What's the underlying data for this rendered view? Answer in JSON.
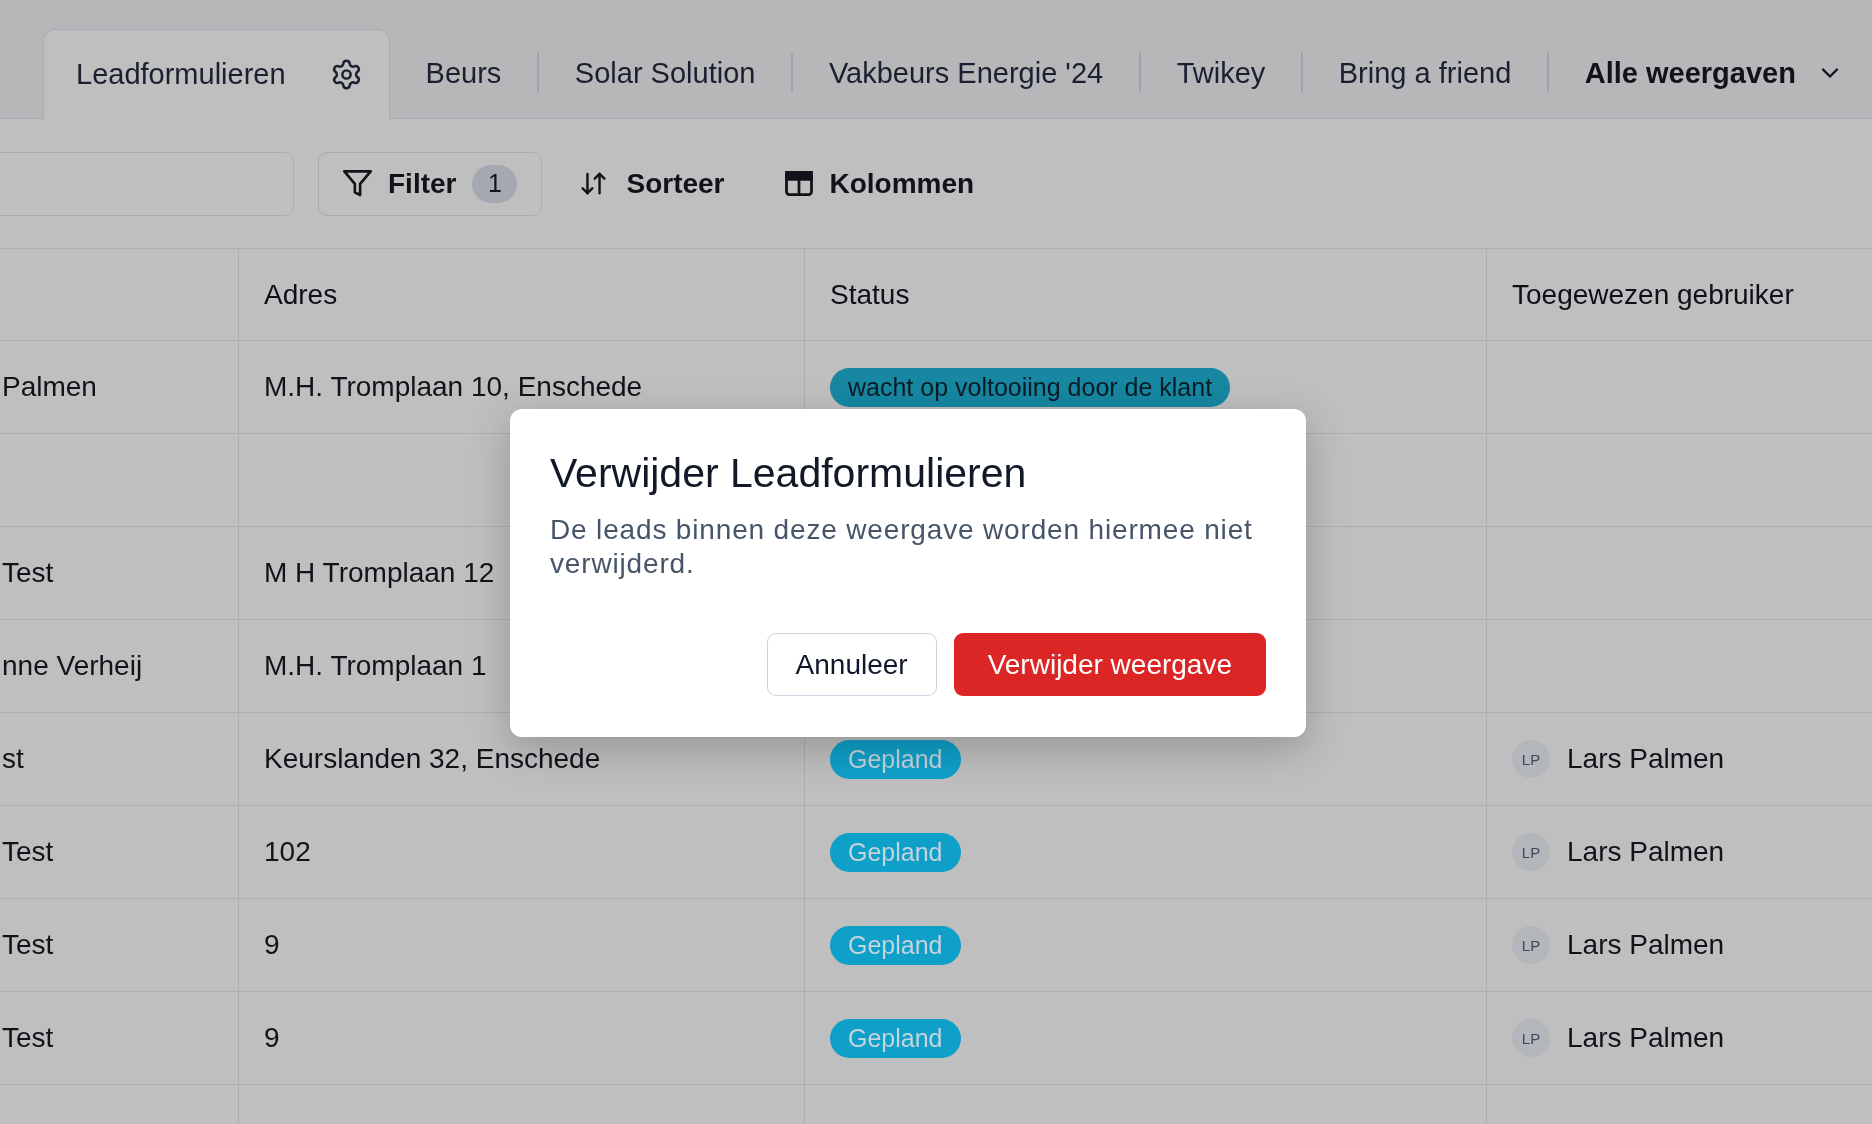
{
  "tabs": [
    {
      "label": "Leadformulieren",
      "selected": true
    },
    {
      "label": "Beurs",
      "selected": false
    },
    {
      "label": "Solar Solution",
      "selected": false
    },
    {
      "label": "Vakbeurs Energie '24",
      "selected": false
    },
    {
      "label": "Twikey",
      "selected": false
    },
    {
      "label": "Bring a friend",
      "selected": false
    }
  ],
  "views_menu": {
    "label": "Alle weergaven"
  },
  "toolbar": {
    "actions": [
      {
        "kind": "filter",
        "label": "Filter",
        "count": "1"
      },
      {
        "kind": "sort",
        "label": "Sorteer"
      },
      {
        "kind": "columns",
        "label": "Kolommen"
      }
    ]
  },
  "table": {
    "columns": [
      "Adres",
      "Status",
      "Toegewezen gebruiker"
    ],
    "rows": [
      {
        "column_1": "Palmen",
        "address": "M.H. Tromplaan 10, Enschede",
        "status": {
          "label": "wacht op voltooiing door de klant",
          "kind": "dark",
          "color": "#1787a2"
        }
      },
      {},
      {
        "column_1": "Test",
        "address": "M H Tromplaan 12"
      },
      {
        "column_1": "nne Verheij",
        "address": "M.H. Tromplaan 1"
      },
      {
        "column_1": "st",
        "address": "Keurslanden 32, Enschede",
        "status": {
          "label": "Gepland",
          "kind": "light",
          "color": "#0fa0c9"
        },
        "assigned_user": {
          "initials": "LP",
          "name": "Lars Palmen"
        }
      },
      {
        "column_1": "Test",
        "address": "102",
        "status": {
          "label": "Gepland",
          "kind": "light",
          "color": "#0fa0c9"
        },
        "assigned_user": {
          "initials": "LP",
          "name": "Lars Palmen"
        }
      },
      {
        "column_1": "Test",
        "address": "9",
        "status": {
          "label": "Gepland",
          "kind": "light",
          "color": "#0fa0c9"
        },
        "assigned_user": {
          "initials": "LP",
          "name": "Lars Palmen"
        }
      },
      {
        "column_1": "Test",
        "address": "9",
        "status": {
          "label": "Gepland",
          "kind": "light",
          "color": "#0fa0c9"
        },
        "assigned_user": {
          "initials": "LP",
          "name": "Lars Palmen"
        }
      }
    ]
  },
  "dialog": {
    "title": "Verwijder Leadformulieren",
    "message": "De leads binnen deze weergave worden hiermee niet verwijderd.",
    "buttons": [
      {
        "kind": "secondary",
        "label": "Annuleer"
      },
      {
        "kind": "danger",
        "label": "Verwijder weergave"
      }
    ]
  }
}
